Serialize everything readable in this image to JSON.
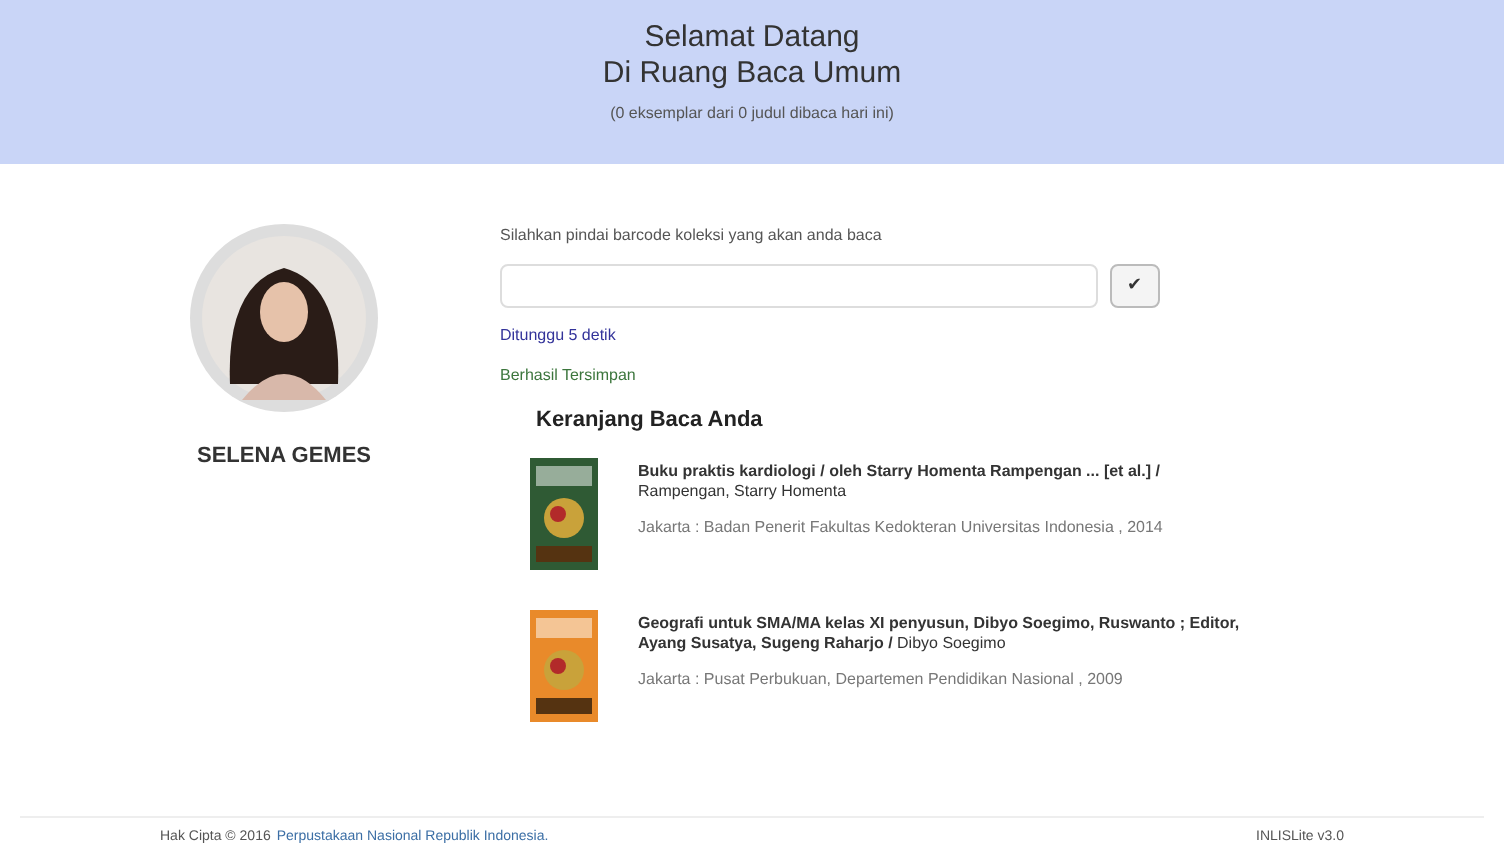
{
  "header": {
    "title_line_1": "Selamat Datang",
    "title_line_2": "Di Ruang Baca Umum",
    "subtitle": "(0 eksemplar dari 0 judul dibaca hari ini)"
  },
  "member": {
    "name": "SELENA GEMES"
  },
  "scan": {
    "prompt": "Silahkan pindai barcode koleksi yang akan anda baca",
    "submit_icon": "✔",
    "wait_text": "Ditunggu 5 detik",
    "status": "Berhasil Tersimpan"
  },
  "basket": {
    "title": "Keranjang Baca Anda",
    "books": [
      {
        "title": "**Buku praktis kardiologi / oleh Starry Homenta Rampengan ... [et al.] /** Rampengan, Starry Homenta",
        "publisher": "Jakarta : Badan Penerit Fakultas Kedokteran Universitas Indonesia , 2014"
      },
      {
        "title": "**Geografi untuk SMA/MA kelas XI penyusun, Dibyo Soegimo, Ruswanto ; Editor, Ayang Susatya, Sugeng Raharjo /** Dibyo Soegimo",
        "publisher": "Jakarta : Pusat Perbukuan, Departemen Pendidikan Nasional , 2009"
      }
    ]
  },
  "footer": {
    "copyright": "Hak Cipta © 2016",
    "link": "Perpustakaan Nasional Republik Indonesia.",
    "version": "INLISLite v3.0"
  }
}
